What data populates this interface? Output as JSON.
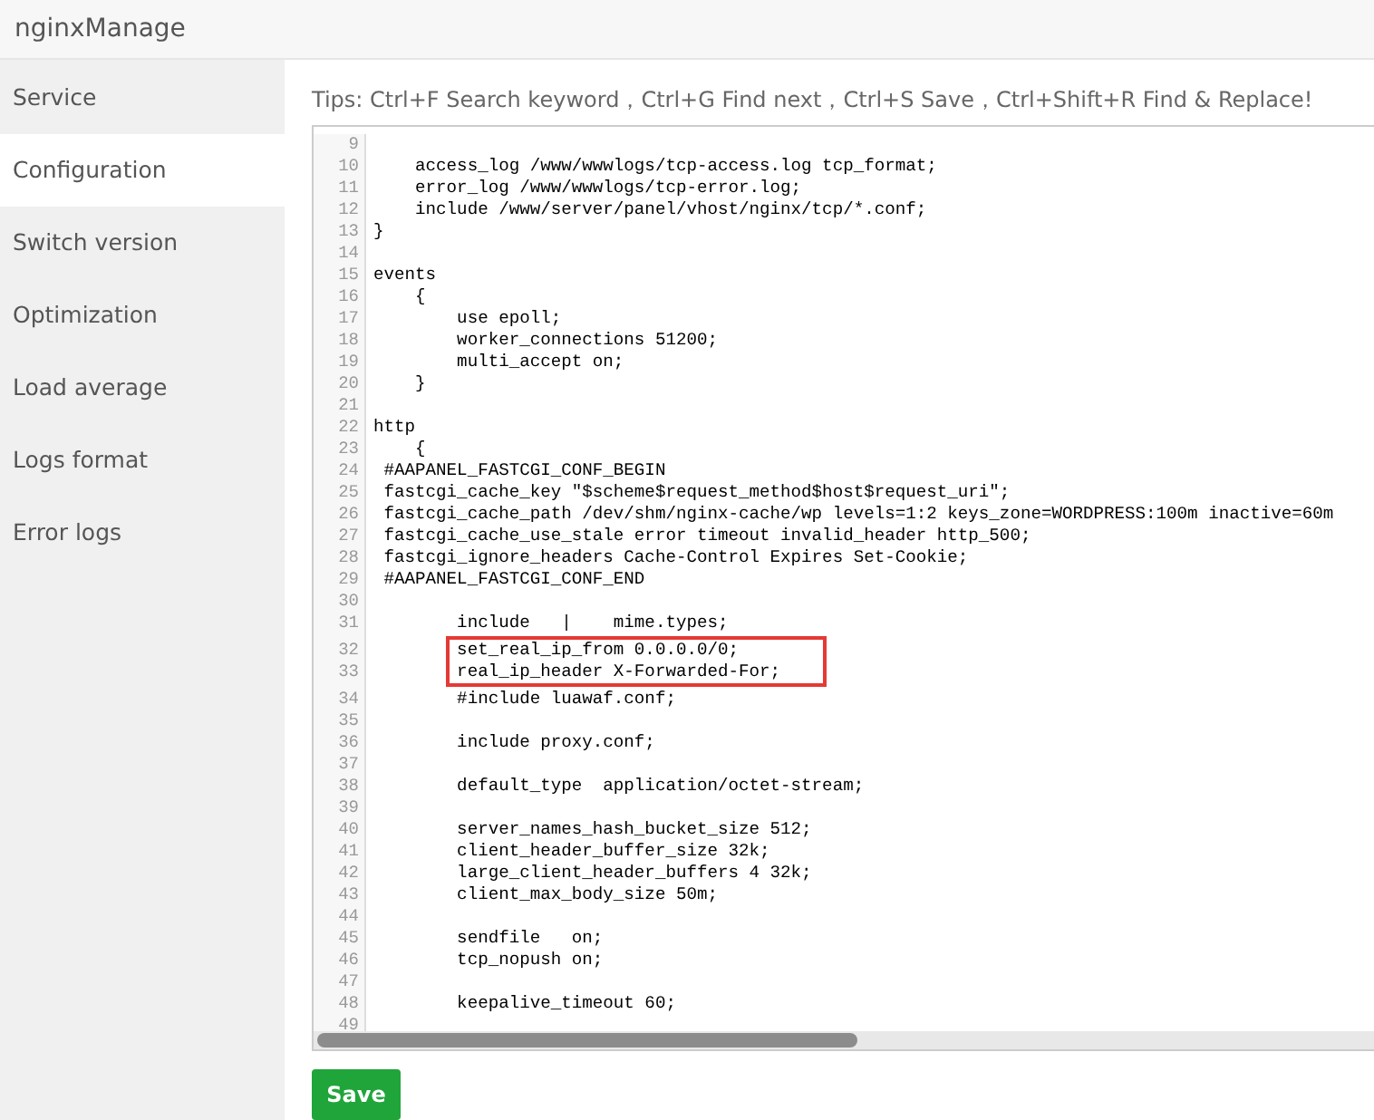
{
  "header": {
    "title": "nginxManage"
  },
  "sidebar": {
    "items": [
      {
        "label": "Service",
        "selected": false
      },
      {
        "label": "Configuration",
        "selected": true
      },
      {
        "label": "Switch version",
        "selected": false
      },
      {
        "label": "Optimization",
        "selected": false
      },
      {
        "label": "Load average",
        "selected": false
      },
      {
        "label": "Logs format",
        "selected": false
      },
      {
        "label": "Error logs",
        "selected": false
      }
    ]
  },
  "tips": "Tips:  Ctrl+F Search keyword，Ctrl+G Find next，Ctrl+S Save，Ctrl+Shift+R Find & Replace!",
  "editor": {
    "lines": [
      {
        "number": "9",
        "highlighted": false
      },
      {
        "number": "10",
        "text": "    access_log /www/wwwlogs/tcp-access.log tcp_format;",
        "highlighted": false
      },
      {
        "number": "11",
        "text": "    error_log /www/wwwlogs/tcp-error.log;",
        "highlighted": false
      },
      {
        "number": "12",
        "text": "    include /www/server/panel/vhost/nginx/tcp/*.conf;",
        "highlighted": false
      },
      {
        "number": "13",
        "text": "}",
        "highlighted": false
      },
      {
        "number": "14",
        "highlighted": false
      },
      {
        "number": "15",
        "text": "events",
        "highlighted": false
      },
      {
        "number": "16",
        "text": "    {",
        "highlighted": false
      },
      {
        "number": "17",
        "text": "        use epoll;",
        "highlighted": false
      },
      {
        "number": "18",
        "text": "        worker_connections 51200;",
        "highlighted": false
      },
      {
        "number": "19",
        "text": "        multi_accept on;",
        "highlighted": false
      },
      {
        "number": "20",
        "text": "    }",
        "highlighted": false
      },
      {
        "number": "21",
        "highlighted": false
      },
      {
        "number": "22",
        "text": "http",
        "highlighted": false
      },
      {
        "number": "23",
        "text": "    {",
        "highlighted": false
      },
      {
        "number": "24",
        "text": " #AAPANEL_FASTCGI_CONF_BEGIN",
        "highlighted": false
      },
      {
        "number": "25",
        "text": " fastcgi_cache_key \"$scheme$request_method$host$request_uri\";",
        "highlighted": false
      },
      {
        "number": "26",
        "text": " fastcgi_cache_path /dev/shm/nginx-cache/wp levels=1:2 keys_zone=WORDPRESS:100m inactive=60m",
        "highlighted": false
      },
      {
        "number": "27",
        "text": " fastcgi_cache_use_stale error timeout invalid_header http_500;",
        "highlighted": false
      },
      {
        "number": "28",
        "text": " fastcgi_ignore_headers Cache-Control Expires Set-Cookie;",
        "highlighted": false
      },
      {
        "number": "29",
        "text": " #AAPANEL_FASTCGI_CONF_END",
        "highlighted": false
      },
      {
        "number": "30",
        "highlighted": false
      },
      {
        "number": "31",
        "text": "        include   |    mime.types;",
        "highlighted": false
      },
      {
        "number": "32",
        "text": "        set_real_ip_from 0.0.0.0/0;",
        "highlighted": true
      },
      {
        "number": "33",
        "text": "        real_ip_header X-Forwarded-For;",
        "highlighted": true
      },
      {
        "number": "34",
        "text": "        #include luawaf.conf;",
        "highlighted": false
      },
      {
        "number": "35",
        "highlighted": false
      },
      {
        "number": "36",
        "text": "        include proxy.conf;",
        "highlighted": false
      },
      {
        "number": "37",
        "highlighted": false
      },
      {
        "number": "38",
        "text": "        default_type  application/octet-stream;",
        "highlighted": false
      },
      {
        "number": "39",
        "highlighted": false
      },
      {
        "number": "40",
        "text": "        server_names_hash_bucket_size 512;",
        "highlighted": false
      },
      {
        "number": "41",
        "text": "        client_header_buffer_size 32k;",
        "highlighted": false
      },
      {
        "number": "42",
        "text": "        large_client_header_buffers 4 32k;",
        "highlighted": false
      },
      {
        "number": "43",
        "text": "        client_max_body_size 50m;",
        "highlighted": false
      },
      {
        "number": "44",
        "highlighted": false
      },
      {
        "number": "45",
        "text": "        sendfile   on;",
        "highlighted": false
      },
      {
        "number": "46",
        "text": "        tcp_nopush on;",
        "highlighted": false
      },
      {
        "number": "47",
        "highlighted": false
      },
      {
        "number": "48",
        "text": "        keepalive_timeout 60;",
        "highlighted": false
      },
      {
        "number": "49",
        "highlighted": false
      }
    ]
  },
  "save_button": "Save"
}
